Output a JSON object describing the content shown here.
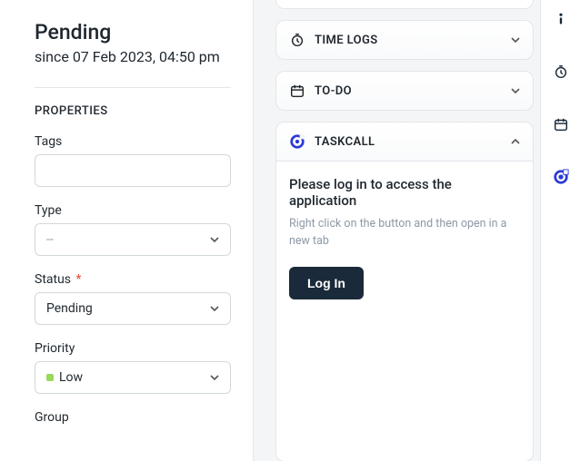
{
  "left": {
    "status_title": "Pending",
    "status_since": "since 07 Feb 2023, 04:50 pm",
    "section_label": "PROPERTIES",
    "fields": {
      "tags_label": "Tags",
      "tags_value": "",
      "type_label": "Type",
      "type_placeholder": "--",
      "type_value": "",
      "status_label": "Status",
      "status_required_mark": "*",
      "status_value": "Pending",
      "priority_label": "Priority",
      "priority_value": "Low",
      "priority_color": "#98d85b",
      "group_label": "Group"
    }
  },
  "main": {
    "timelogs_label": "TIME LOGS",
    "todo_label": "TO-DO",
    "taskcall_header": "TASKCALL",
    "taskcall_title": "Please log in to access the application",
    "taskcall_sub": "Right click on the button and then open in a new tab",
    "login_label": "Log In"
  }
}
